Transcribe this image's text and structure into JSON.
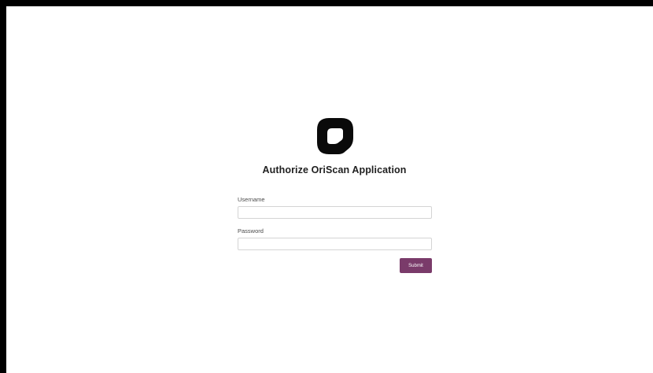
{
  "page": {
    "title": "Authorize OriScan Application"
  },
  "logo": {
    "icon": "oriscan-logo-icon",
    "color": "#0a0a0a"
  },
  "form": {
    "username_label": "Username",
    "username_value": "",
    "password_label": "Password",
    "password_value": "",
    "submit_label": "Submit",
    "submit_color": "#7a3b6a"
  }
}
